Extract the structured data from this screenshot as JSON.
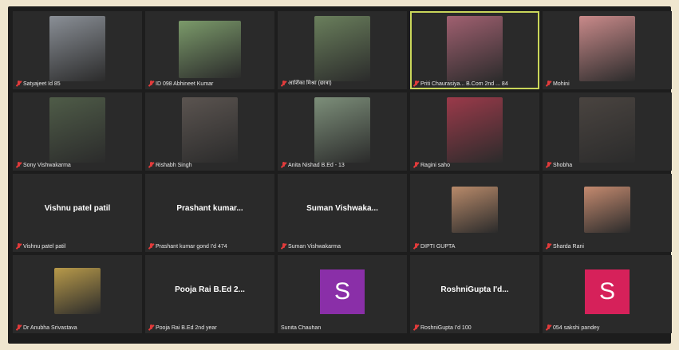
{
  "tiles": [
    {
      "name": "Satyajeet Id 85",
      "photo": "#8a8f96",
      "active": false
    },
    {
      "name": "ID 098 Abhineet Kumar",
      "photo": "#7b9a6a",
      "active": false
    },
    {
      "name": "आर्शिका मिश्रा (छात्रा)",
      "photo": "#6a7f5c",
      "active": false
    },
    {
      "name": "Priti Chaurasiya... B.Com 2nd ... 84",
      "photo": "#a06070",
      "active": true
    },
    {
      "name": "Mohini",
      "photo": "#c98a8a",
      "active": false
    },
    {
      "name": "Sony Vishwakarma",
      "photo": "#4f5c48",
      "active": false
    },
    {
      "name": "Rishabh Singh",
      "photo": "#5b5450",
      "active": false
    },
    {
      "name": "Anita Nishad B.Ed - 13",
      "photo": "#7d8f7a",
      "active": false
    },
    {
      "name": "Ragini saho",
      "photo": "#9b3a4a",
      "active": false
    },
    {
      "name": "Shobha",
      "photo": "#4a4440",
      "active": false
    },
    {
      "name": "Vishnu patel patil",
      "center": "Vishnu patel patil"
    },
    {
      "name": "Prashant kumar gond I'd 474",
      "center": "Prashant kumar..."
    },
    {
      "name": "Suman Vishwakarma",
      "center": "Suman Vishwaka..."
    },
    {
      "name": "DIPTI GUPTA",
      "photo": "#b88a6a",
      "active": false
    },
    {
      "name": "Sharda Rani",
      "photo": "#c48a6f",
      "active": false
    },
    {
      "name": "Dr Anubha Srivastava",
      "photo": "#b89a4a",
      "active": false
    },
    {
      "name": "Pooja Rai B.Ed 2nd year",
      "center": "Pooja Rai B.Ed 2..."
    },
    {
      "name": "Sunita Chauhan",
      "avatar": "S",
      "avatar_color": "#8a2fa8",
      "nomic": true
    },
    {
      "name": "RoshniGupta I'd 100",
      "center": "RoshniGupta I'd..."
    },
    {
      "name": "054 sakshi pandey",
      "avatar": "S",
      "avatar_color": "#d6215a"
    }
  ]
}
